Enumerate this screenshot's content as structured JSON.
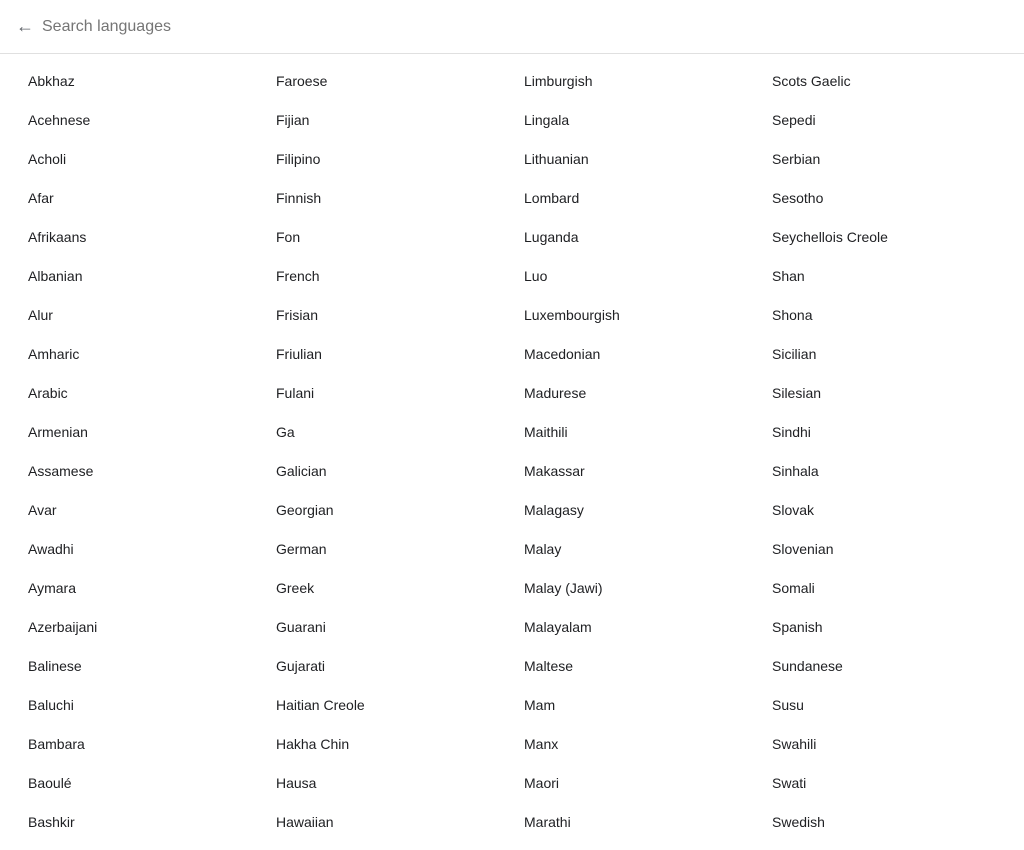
{
  "header": {
    "back_label": "←",
    "search_placeholder": "Search languages"
  },
  "colors": {
    "accent": "#1a73e8",
    "text": "#202124",
    "secondary": "#5f6368",
    "border": "#e0e0e0"
  },
  "languages": [
    [
      "Abkhaz",
      "Faroese",
      "Limburgish",
      "Scots Gaelic"
    ],
    [
      "Acehnese",
      "Fijian",
      "Lingala",
      "Sepedi"
    ],
    [
      "Acholi",
      "Filipino",
      "Lithuanian",
      "Serbian"
    ],
    [
      "Afar",
      "Finnish",
      "Lombard",
      "Sesotho"
    ],
    [
      "Afrikaans",
      "Fon",
      "Luganda",
      "Seychellois Creole"
    ],
    [
      "Albanian",
      "French",
      "Luo",
      "Shan"
    ],
    [
      "Alur",
      "Frisian",
      "Luxembourgish",
      "Shona"
    ],
    [
      "Amharic",
      "Friulian",
      "Macedonian",
      "Sicilian"
    ],
    [
      "Arabic",
      "Fulani",
      "Madurese",
      "Silesian"
    ],
    [
      "Armenian",
      "Ga",
      "Maithili",
      "Sindhi"
    ],
    [
      "Assamese",
      "Galician",
      "Makassar",
      "Sinhala"
    ],
    [
      "Avar",
      "Georgian",
      "Malagasy",
      "Slovak"
    ],
    [
      "Awadhi",
      "German",
      "Malay",
      "Slovenian"
    ],
    [
      "Aymara",
      "Greek",
      "Malay (Jawi)",
      "Somali"
    ],
    [
      "Azerbaijani",
      "Guarani",
      "Malayalam",
      "Spanish"
    ],
    [
      "Balinese",
      "Gujarati",
      "Maltese",
      "Sundanese"
    ],
    [
      "Baluchi",
      "Haitian Creole",
      "Mam",
      "Susu"
    ],
    [
      "Bambara",
      "Hakha Chin",
      "Manx",
      "Swahili"
    ],
    [
      "Baoulé",
      "Hausa",
      "Maori",
      "Swati"
    ],
    [
      "Bashkir",
      "Hawaiian",
      "Marathi",
      "Swedish"
    ]
  ]
}
